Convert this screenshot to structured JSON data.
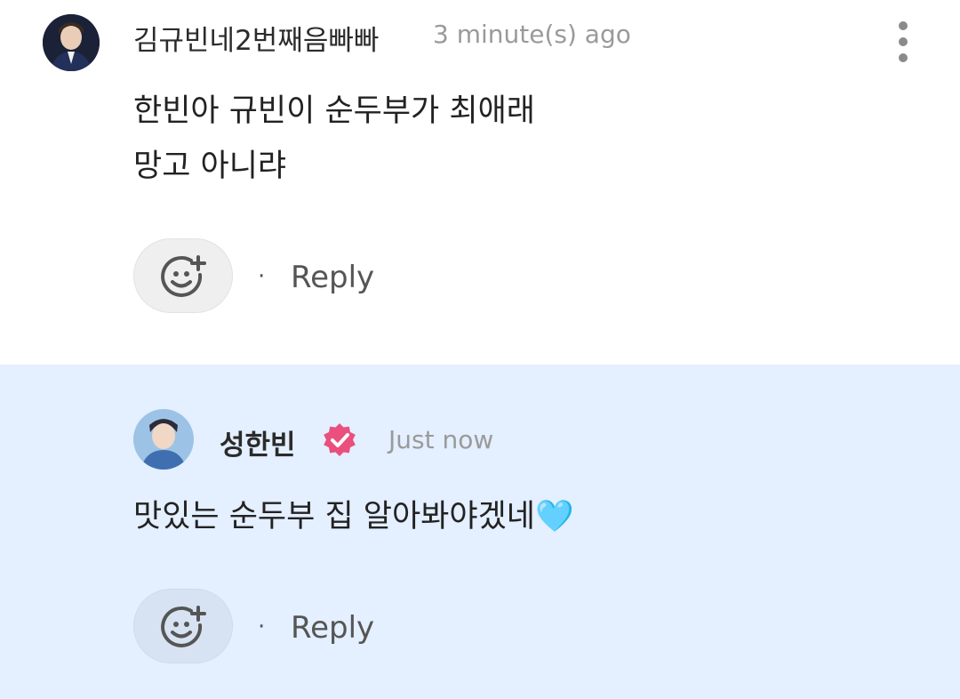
{
  "comments": [
    {
      "author": "김규빈네2번째음빠빠",
      "time": "3 minute(s) ago",
      "text_line1": "한빈아 규빈이 순두부가 최애래",
      "text_line2": "망고 아니랴",
      "reply_label": "Reply",
      "separator": "·"
    },
    {
      "author": "성한빈",
      "time": "Just now",
      "text_line1": "맛있는 순두부 집 알아봐야겠네",
      "emoji": "🩵",
      "reply_label": "Reply",
      "separator": "·"
    }
  ],
  "colors": {
    "reply_bg": "#e4efff",
    "badge": "#ea4f7e",
    "text_muted": "#9a9a9a"
  },
  "icons": [
    "add-reaction-icon",
    "more-options-icon",
    "verified-badge-icon"
  ]
}
